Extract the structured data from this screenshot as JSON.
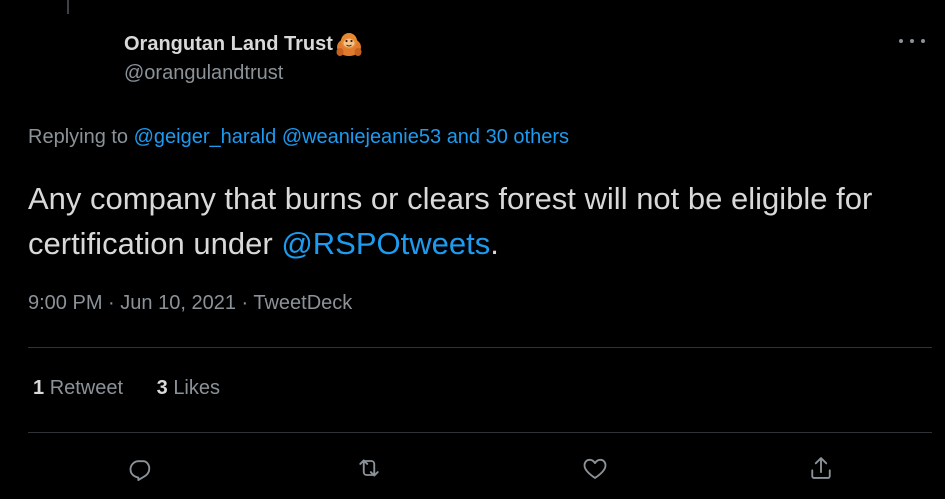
{
  "tweet": {
    "display_name": "Orangutan Land Trust",
    "handle": "@orangulandtrust",
    "replying_prefix": "Replying to",
    "replying_to": [
      "@geiger_harald",
      "@weaniejeanie53"
    ],
    "replying_others": "and 30 others",
    "text_before_link": "Any company that burns or clears forest will not be eligible for certification under ",
    "text_link": "@RSPOtweets",
    "text_after_link": ".",
    "time": "9:00 PM",
    "separator": "·",
    "date": "Jun 10, 2021",
    "source": "TweetDeck"
  },
  "stats": {
    "retweets_count": "1",
    "retweets_label": "Retweet",
    "likes_count": "3",
    "likes_label": "Likes"
  },
  "icons": {
    "more": "more-horizontal-icon",
    "emoji": "orangutan-emoji-icon",
    "reply": "reply-icon",
    "retweet": "retweet-icon",
    "like": "heart-icon",
    "share": "share-icon"
  },
  "colors": {
    "background": "#000000",
    "text": "#d9d9d9",
    "muted": "#8b9298",
    "link": "#1d9bf0",
    "divider": "#2f3336"
  }
}
